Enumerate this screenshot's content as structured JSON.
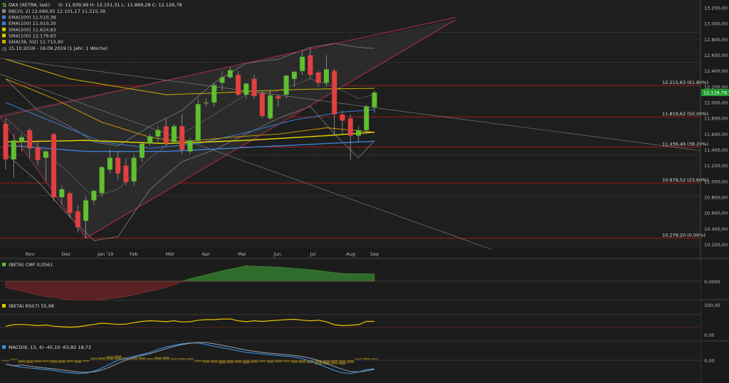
{
  "header": {
    "title": "DAX (XETRA, last)",
    "ohlc": "O: 11.939,99  H: 12.151,31  L: 11.869,28  C: 12.126,78",
    "daterange": "15.10.2018 - 16.09.2019  (1 Jahr, 1 Woche)"
  },
  "legend": [
    {
      "text": "BB(20, 2)  12.686,95  12.101,17  11.515,38",
      "color": "#8a8a8a"
    },
    {
      "text": "EMA(200)  11.510,38",
      "color": "#3d7fd6"
    },
    {
      "text": "EMA(100)  11.910,30",
      "color": "#3d7fd6"
    },
    {
      "text": "SMA(200)  11.624,83",
      "color": "#d8c800"
    },
    {
      "text": "SMA(100)  12.179,83",
      "color": "#d8c800"
    },
    {
      "text": "SMA(38, hl2)  11.713,90",
      "color": "#d8a000"
    }
  ],
  "last_price": "12.126,78",
  "fib_labels": [
    {
      "price": 12215.63,
      "text": "12.215,63 (61.80%)"
    },
    {
      "price": 11819.62,
      "text": "11.819,62 (50.00%)"
    },
    {
      "price": 11436.46,
      "text": "11.436,46 (38.20%)"
    },
    {
      "price": 10979.52,
      "text": "10.979,52 (23.60%)"
    },
    {
      "price": 10279.2,
      "text": "10.279,20 (0.00%)"
    }
  ],
  "y_ticks": [
    "13.200,00",
    "13.000,00",
    "12.800,00",
    "12.600,00",
    "12.400,00",
    "12.200,00",
    "12.000,00",
    "11.800,00",
    "11.600,00",
    "11.400,00",
    "11.200,00",
    "11.000,00",
    "10.800,00",
    "10.600,00",
    "10.400,00",
    "10.200,00"
  ],
  "x_ticks": [
    "Nov",
    "Dez",
    "Jan '19",
    "Feb",
    "Mär",
    "Apr",
    "Mai",
    "Jun",
    "Jul",
    "Aug",
    "Sep"
  ],
  "cmf": {
    "label": "(BETA) CMF  0,0561",
    "axis": "0,0000"
  },
  "rsi": {
    "label": "(BETA) RSI(7)  55,98",
    "axis_top": "100,00",
    "axis_bottom": "0,00"
  },
  "macd": {
    "label": "MACD(8, 13, 4)  -45,10  -63,82  18,72",
    "axis": "0,00"
  },
  "colors": {
    "up": "#5fbf2f",
    "down": "#e04040",
    "bg": "#1a1a1a",
    "fib": "#b01818"
  },
  "chart_data": {
    "type": "candlestick",
    "title": "DAX (XETRA, last)",
    "ylim": [
      10150,
      13300
    ],
    "candles": [
      {
        "x": "2018-10-15",
        "o": 11730,
        "h": 11800,
        "l": 11150,
        "c": 11280
      },
      {
        "x": "2018-10-22",
        "o": 11280,
        "h": 11600,
        "l": 11050,
        "c": 11520
      },
      {
        "x": "2018-10-29",
        "o": 11500,
        "h": 11600,
        "l": 11380,
        "c": 11560
      },
      {
        "x": "2018-11-05",
        "o": 11650,
        "h": 11680,
        "l": 11300,
        "c": 11420
      },
      {
        "x": "2018-11-12",
        "o": 11430,
        "h": 11500,
        "l": 11200,
        "c": 11270
      },
      {
        "x": "2018-11-19",
        "o": 11300,
        "h": 11400,
        "l": 11000,
        "c": 11380
      },
      {
        "x": "2018-11-26",
        "o": 11600,
        "h": 11620,
        "l": 10750,
        "c": 10800
      },
      {
        "x": "2018-12-03",
        "o": 10800,
        "h": 10950,
        "l": 10700,
        "c": 10900
      },
      {
        "x": "2018-12-10",
        "o": 10850,
        "h": 10870,
        "l": 10550,
        "c": 10600
      },
      {
        "x": "2018-12-17",
        "o": 10620,
        "h": 10700,
        "l": 10350,
        "c": 10420
      },
      {
        "x": "2018-12-24",
        "o": 10500,
        "h": 10820,
        "l": 10280,
        "c": 10760
      },
      {
        "x": "2018-12-31",
        "o": 10760,
        "h": 10900,
        "l": 10700,
        "c": 10880
      },
      {
        "x": "2019-01-07",
        "o": 10850,
        "h": 11200,
        "l": 10800,
        "c": 11180
      },
      {
        "x": "2019-01-14",
        "o": 11150,
        "h": 11400,
        "l": 11100,
        "c": 11300
      },
      {
        "x": "2019-01-21",
        "o": 11300,
        "h": 11380,
        "l": 11020,
        "c": 11100
      },
      {
        "x": "2019-01-28",
        "o": 11200,
        "h": 11300,
        "l": 10950,
        "c": 10990
      },
      {
        "x": "2019-02-04",
        "o": 11000,
        "h": 11350,
        "l": 10950,
        "c": 11300
      },
      {
        "x": "2019-02-11",
        "o": 11300,
        "h": 11500,
        "l": 11250,
        "c": 11480
      },
      {
        "x": "2019-02-18",
        "o": 11480,
        "h": 11600,
        "l": 11450,
        "c": 11570
      },
      {
        "x": "2019-02-25",
        "o": 11570,
        "h": 11700,
        "l": 11500,
        "c": 11650
      },
      {
        "x": "2019-03-04",
        "o": 11700,
        "h": 11800,
        "l": 11450,
        "c": 11480
      },
      {
        "x": "2019-03-11",
        "o": 11500,
        "h": 11730,
        "l": 11480,
        "c": 11700
      },
      {
        "x": "2019-03-18",
        "o": 11700,
        "h": 11850,
        "l": 11350,
        "c": 11400
      },
      {
        "x": "2019-03-25",
        "o": 11380,
        "h": 11550,
        "l": 11350,
        "c": 11520
      },
      {
        "x": "2019-04-01",
        "o": 11520,
        "h": 12050,
        "l": 11500,
        "c": 11980
      },
      {
        "x": "2019-04-08",
        "o": 11990,
        "h": 12050,
        "l": 11950,
        "c": 12000
      },
      {
        "x": "2019-04-15",
        "o": 12000,
        "h": 12250,
        "l": 11950,
        "c": 12220
      },
      {
        "x": "2019-04-22",
        "o": 12250,
        "h": 12400,
        "l": 12150,
        "c": 12320
      },
      {
        "x": "2019-04-29",
        "o": 12320,
        "h": 12450,
        "l": 12300,
        "c": 12410
      },
      {
        "x": "2019-05-06",
        "o": 12350,
        "h": 12400,
        "l": 12080,
        "c": 12100
      },
      {
        "x": "2019-05-13",
        "o": 12100,
        "h": 12250,
        "l": 12050,
        "c": 12240
      },
      {
        "x": "2019-05-20",
        "o": 12300,
        "h": 12350,
        "l": 12050,
        "c": 12080
      },
      {
        "x": "2019-05-27",
        "o": 12120,
        "h": 12150,
        "l": 11800,
        "c": 11830
      },
      {
        "x": "2019-06-03",
        "o": 11800,
        "h": 12150,
        "l": 11780,
        "c": 12090
      },
      {
        "x": "2019-06-10",
        "o": 12080,
        "h": 12100,
        "l": 11950,
        "c": 12050
      },
      {
        "x": "2019-06-17",
        "o": 12100,
        "h": 12350,
        "l": 12050,
        "c": 12340
      },
      {
        "x": "2019-06-24",
        "o": 12300,
        "h": 12400,
        "l": 12200,
        "c": 12390
      },
      {
        "x": "2019-07-01",
        "o": 12400,
        "h": 12650,
        "l": 12350,
        "c": 12580
      },
      {
        "x": "2019-07-08",
        "o": 12600,
        "h": 12700,
        "l": 12300,
        "c": 12350
      },
      {
        "x": "2019-07-15",
        "o": 12380,
        "h": 12400,
        "l": 12200,
        "c": 12250
      },
      {
        "x": "2019-07-22",
        "o": 12250,
        "h": 12600,
        "l": 12200,
        "c": 12420
      },
      {
        "x": "2019-07-29",
        "o": 12400,
        "h": 12430,
        "l": 11600,
        "c": 11850
      },
      {
        "x": "2019-08-05",
        "o": 11850,
        "h": 11900,
        "l": 11600,
        "c": 11770
      },
      {
        "x": "2019-08-12",
        "o": 11800,
        "h": 11850,
        "l": 11270,
        "c": 11580
      },
      {
        "x": "2019-08-19",
        "o": 11580,
        "h": 11700,
        "l": 11500,
        "c": 11650
      },
      {
        "x": "2019-08-26",
        "o": 11650,
        "h": 11970,
        "l": 11600,
        "c": 11950
      },
      {
        "x": "2019-09-02",
        "o": 11940,
        "h": 12151,
        "l": 11869,
        "c": 12127
      }
    ]
  }
}
